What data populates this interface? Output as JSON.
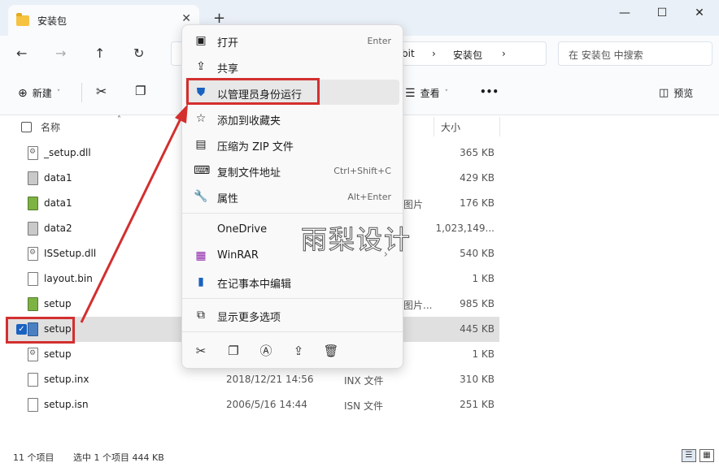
{
  "window": {
    "tab_title": "安装包",
    "tab_close": "✕",
    "new_tab": "+",
    "minimize": "—",
    "maximize": "☐",
    "close": "✕"
  },
  "address": {
    "crumbs": [
      "bit",
      "安装包"
    ],
    "crumb_sep": "›",
    "search_placeholder": "在 安装包 中搜索"
  },
  "toolbar": {
    "new_label": "新建",
    "view_label": "查看",
    "preview_label": "预览",
    "more": "•••"
  },
  "columns": {
    "name": "名称",
    "size": "大小"
  },
  "files": [
    {
      "name": "_setup.dll",
      "date": "",
      "type": "",
      "size": "365 KB",
      "icon": "dll-file-icon"
    },
    {
      "name": "data1",
      "date": "",
      "type": "",
      "size": "429 KB",
      "icon": "cab-file-icon"
    },
    {
      "name": "data1",
      "date": "",
      "type": "图片",
      "size": "176 KB",
      "icon": "image-file-icon"
    },
    {
      "name": "data2",
      "date": "",
      "type": "",
      "size": "1,023,149...",
      "icon": "cab-file-icon"
    },
    {
      "name": "ISSetup.dll",
      "date": "",
      "type": "",
      "size": "540 KB",
      "icon": "dll-file-icon"
    },
    {
      "name": "layout.bin",
      "date": "",
      "type": "",
      "size": "1 KB",
      "icon": "generic-file-icon"
    },
    {
      "name": "setup",
      "date": "",
      "type": "图片...",
      "size": "985 KB",
      "icon": "image-file-icon"
    },
    {
      "name": "setup",
      "date": "",
      "type": "",
      "size": "445 KB",
      "icon": "exe-file-icon"
    },
    {
      "name": "setup",
      "date": "",
      "type": "",
      "size": "1 KB",
      "icon": "ini-file-icon"
    },
    {
      "name": "setup.inx",
      "date": "2018/12/21 14:56",
      "type": "INX 文件",
      "size": "310 KB",
      "icon": "generic-file-icon"
    },
    {
      "name": "setup.isn",
      "date": "2006/5/16 14:44",
      "type": "ISN 文件",
      "size": "251 KB",
      "icon": "generic-file-icon"
    }
  ],
  "context_menu": {
    "items": [
      {
        "label": "打开",
        "shortcut": "Enter",
        "icon": "open-icon"
      },
      {
        "label": "共享",
        "shortcut": "",
        "icon": "share-icon"
      },
      {
        "label": "以管理员身份运行",
        "shortcut": "",
        "icon": "shield-icon"
      },
      {
        "label": "添加到收藏夹",
        "shortcut": "",
        "icon": "star-icon"
      },
      {
        "label": "压缩为 ZIP 文件",
        "shortcut": "",
        "icon": "zip-icon"
      },
      {
        "label": "复制文件地址",
        "shortcut": "Ctrl+Shift+C",
        "icon": "copy-path-icon"
      },
      {
        "label": "属性",
        "shortcut": "Alt+Enter",
        "icon": "wrench-icon"
      },
      {
        "label": "OneDrive",
        "shortcut": "",
        "icon": "onedrive-icon"
      },
      {
        "label": "WinRAR",
        "shortcut": "",
        "icon": "winrar-icon"
      },
      {
        "label": "在记事本中编辑",
        "shortcut": "",
        "icon": "notepad-icon"
      },
      {
        "label": "显示更多选项",
        "shortcut": "",
        "icon": "more-options-icon"
      }
    ],
    "submenu_arrow": "›"
  },
  "status": {
    "count": "11 个项目",
    "selection": "选中 1 个项目  444 KB"
  },
  "watermark": "雨梨设计",
  "colors": {
    "highlight": "#d32f2f",
    "accent": "#1a62c2"
  }
}
